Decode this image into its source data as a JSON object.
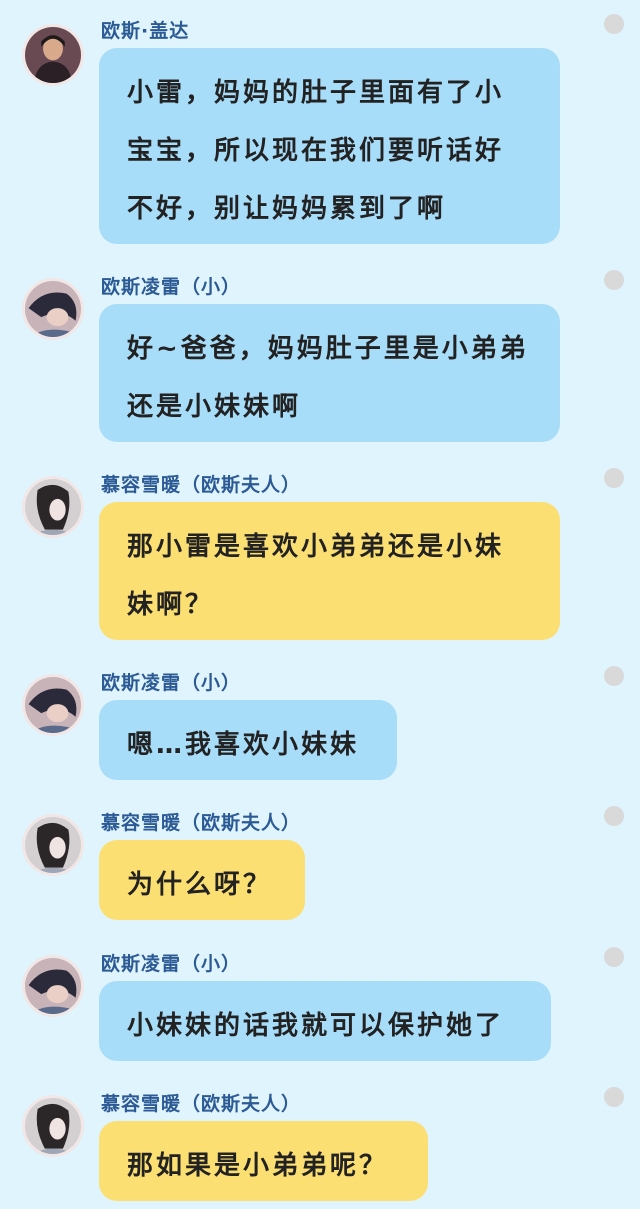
{
  "colors": {
    "background": "#dff4fd",
    "bubble_blue": "#a8ddfa",
    "bubble_yellow": "#fcdf73",
    "name_text": "#2c5a95",
    "dot": "#d9d9d9"
  },
  "messages": [
    {
      "sender": "欧斯·盖达",
      "text": "小雷，妈妈的肚子里面有了小宝宝，所以现在我们要听话好不好，别让妈妈累到了啊",
      "bubble": "blue",
      "avatar": "man-avatar-icon"
    },
    {
      "sender": "欧斯凌雷（小）",
      "text": "好~爸爸，妈妈肚子里是小弟弟还是小妹妹啊",
      "bubble": "blue",
      "avatar": "boy-avatar-icon"
    },
    {
      "sender": "慕容雪暖（欧斯夫人）",
      "text": "那小雷是喜欢小弟弟还是小妹妹啊？",
      "bubble": "yellow",
      "avatar": "woman-avatar-icon"
    },
    {
      "sender": "欧斯凌雷（小）",
      "text": "嗯…我喜欢小妹妹",
      "bubble": "blue",
      "avatar": "boy-avatar-icon"
    },
    {
      "sender": "慕容雪暖（欧斯夫人）",
      "text": "为什么呀？",
      "bubble": "yellow",
      "avatar": "woman-avatar-icon"
    },
    {
      "sender": "欧斯凌雷（小）",
      "text": "小妹妹的话我就可以保护她了",
      "bubble": "blue",
      "avatar": "boy-avatar-icon"
    },
    {
      "sender": "慕容雪暖（欧斯夫人）",
      "text": "那如果是小弟弟呢？",
      "bubble": "yellow",
      "avatar": "woman-avatar-icon"
    }
  ]
}
